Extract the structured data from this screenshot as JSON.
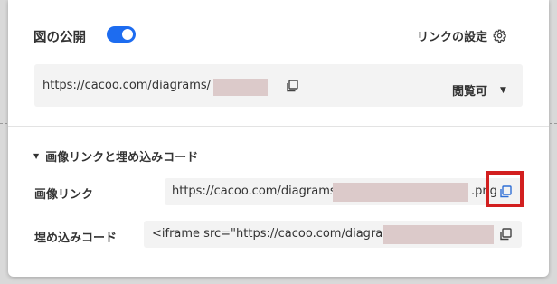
{
  "dialog": {
    "title": "図の公開",
    "publish_toggle_on": true,
    "link_settings_label": "リンクの設定",
    "share_url": "https://cacoo.com/diagrams/",
    "permission_label": "閲覧可",
    "section_label": "画像リンクと埋め込みコード",
    "image_link_label": "画像リンク",
    "image_link_url": "https://cacoo.com/diagrams/",
    "image_link_suffix": ".png",
    "embed_code_label": "埋め込みコード",
    "embed_code_value": "<iframe src=\"https://cacoo.com/diagrams/"
  },
  "colors": {
    "toggle_on": "#1d6cf0",
    "highlight_border": "#d21f1f",
    "mask": "#dccaca"
  },
  "icons": {
    "link_settings": "gear-icon",
    "copy": "copy-icon",
    "dropdown": "caret-down-icon",
    "section": "triangle-down-icon"
  }
}
